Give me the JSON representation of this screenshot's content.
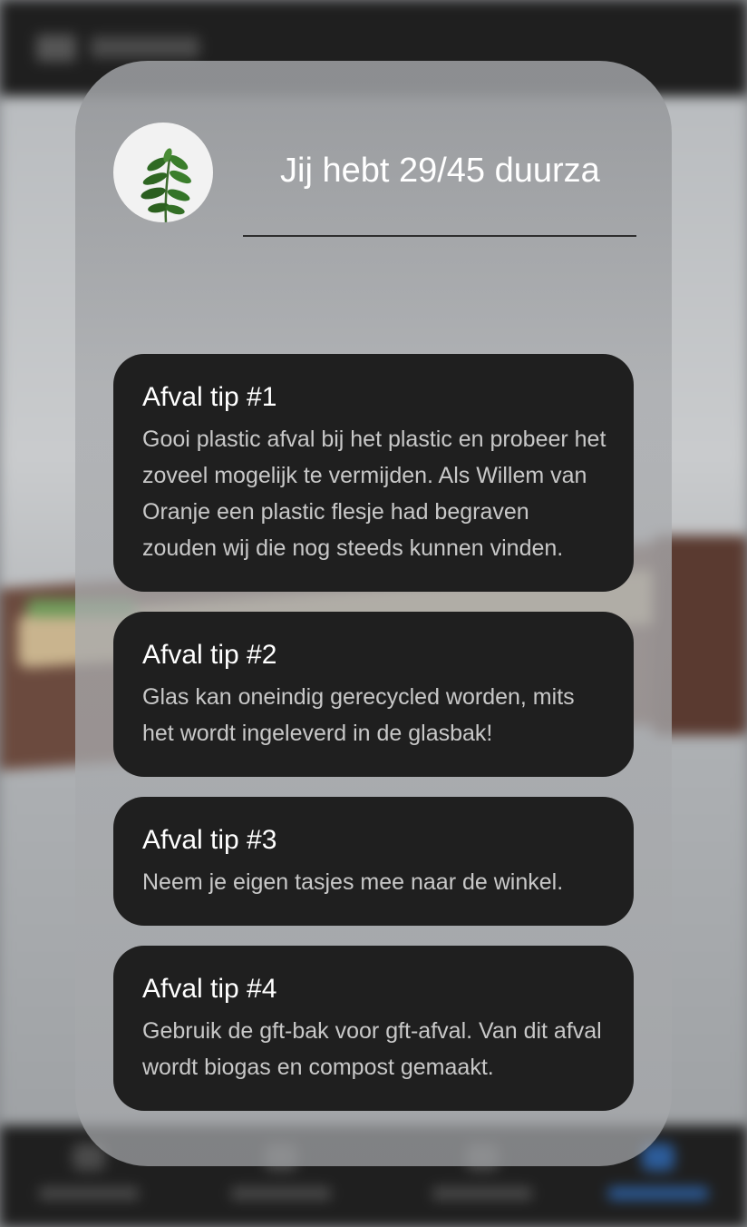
{
  "header": {
    "score_text": "Jij hebt 29/45 duurza"
  },
  "avatar": {
    "icon": "plant-icon"
  },
  "tips": [
    {
      "title": "Afval tip #1",
      "body": "Gooi plastic afval bij het plastic en probeer het zoveel mogelijk te vermijden. Als Willem van Oranje een plastic flesje had begraven zouden wij die nog steeds kunnen vinden."
    },
    {
      "title": "Afval tip #2",
      "body": "Glas kan oneindig gerecycled worden, mits het wordt ingeleverd in de glasbak!"
    },
    {
      "title": "Afval tip #3",
      "body": "Neem je eigen tasjes mee naar de winkel."
    },
    {
      "title": "Afval tip #4",
      "body": "Gebruik de gft-bak voor gft-afval. Van dit afval wordt biogas en compost gemaakt."
    }
  ],
  "colors": {
    "card_background": "#1f1f1f",
    "card_title": "#ffffff",
    "card_body": "#c8c8c8",
    "panel_tint": "#a6a8ab"
  }
}
